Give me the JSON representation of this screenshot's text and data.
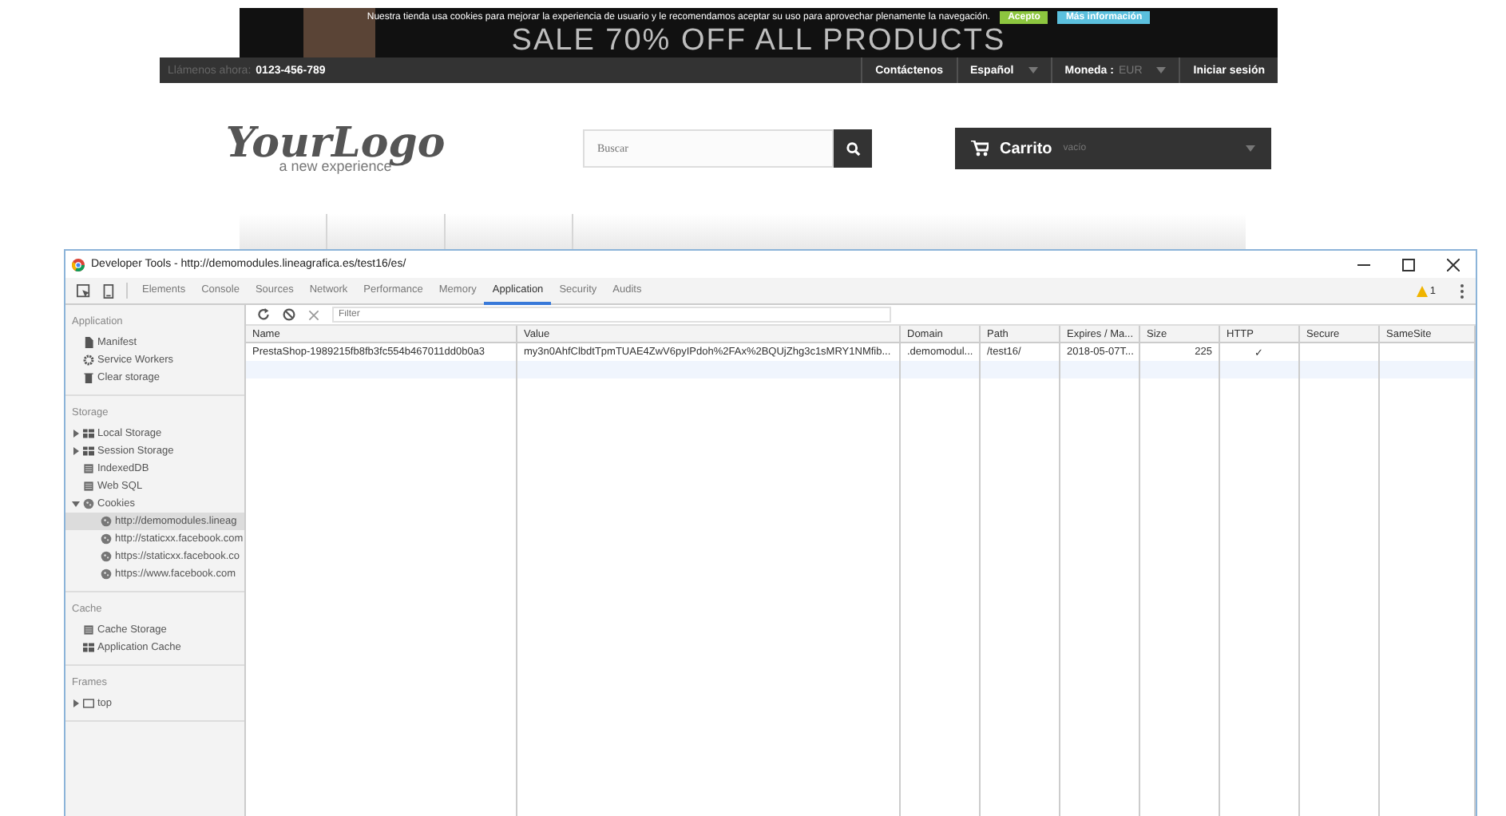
{
  "site": {
    "cookie_notice": {
      "text": "Nuestra tienda usa cookies para mejorar la experiencia de usuario y le recomendamos aceptar su uso para aprovechar plenamente la navegación.",
      "buttons": [
        {
          "label": "Acepto",
          "kind": "accept"
        },
        {
          "label": "Más información",
          "kind": "info"
        }
      ]
    },
    "banner_text": "SALE 70% OFF ALL PRODUCTS",
    "nav": {
      "call_label": "Llámenos ahora:",
      "phone": "0123-456-789",
      "links": [
        {
          "label": "Contáctenos",
          "dropdown": false
        },
        {
          "label": "Español",
          "dropdown": true
        },
        {
          "label": "Moneda :",
          "value": "EUR",
          "dropdown": true
        },
        {
          "label": "Iniciar sesión",
          "dropdown": false
        }
      ]
    },
    "logo": {
      "title": "YourLogo",
      "tagline": "a new experience"
    },
    "search": {
      "placeholder": "Buscar"
    },
    "cart": {
      "label": "Carrito",
      "status": "vacío"
    }
  },
  "devtools": {
    "title": "Developer Tools - http://demomodules.lineagrafica.es/test16/es/",
    "tabs": [
      {
        "label": "Elements",
        "selected": false
      },
      {
        "label": "Console",
        "selected": false
      },
      {
        "label": "Sources",
        "selected": false
      },
      {
        "label": "Network",
        "selected": false
      },
      {
        "label": "Performance",
        "selected": false
      },
      {
        "label": "Memory",
        "selected": false
      },
      {
        "label": "Application",
        "selected": true
      },
      {
        "label": "Security",
        "selected": false
      },
      {
        "label": "Audits",
        "selected": false
      }
    ],
    "warnings": "1",
    "sidebar": [
      {
        "heading": "Application",
        "items": [
          {
            "label": "Manifest",
            "kind": "document",
            "selected": false
          },
          {
            "label": "Service Workers",
            "kind": "gear",
            "selected": false
          },
          {
            "label": "Clear storage",
            "kind": "bin",
            "selected": false
          }
        ]
      },
      {
        "heading": "Storage",
        "items": [
          {
            "label": "Local Storage",
            "kind": "grid",
            "selected": false,
            "expanded": false
          },
          {
            "label": "Session Storage",
            "kind": "grid",
            "selected": false,
            "expanded": false
          },
          {
            "label": "IndexedDB",
            "kind": "database",
            "selected": false
          },
          {
            "label": "Web SQL",
            "kind": "database",
            "selected": false
          },
          {
            "label": "Cookies",
            "kind": "cookie",
            "selected": false,
            "expanded": true,
            "children": [
              {
                "label": "http://demomodules.lineag",
                "kind": "cookie",
                "selected": true
              },
              {
                "label": "http://staticxx.facebook.com",
                "kind": "cookie",
                "selected": false
              },
              {
                "label": "https://staticxx.facebook.co",
                "kind": "cookie",
                "selected": false
              },
              {
                "label": "https://www.facebook.com",
                "kind": "cookie",
                "selected": false
              }
            ]
          }
        ]
      },
      {
        "heading": "Cache",
        "items": [
          {
            "label": "Cache Storage",
            "kind": "database",
            "selected": false
          },
          {
            "label": "Application Cache",
            "kind": "grid",
            "selected": false
          }
        ]
      },
      {
        "heading": "Frames",
        "items": [
          {
            "label": "top",
            "kind": "frame",
            "selected": false,
            "expanded": false
          }
        ]
      }
    ],
    "filter": {
      "placeholder": "Filter"
    },
    "table": {
      "columns": [
        {
          "label": "Name",
          "kind": "text"
        },
        {
          "label": "Value",
          "kind": "text"
        },
        {
          "label": "Domain",
          "kind": "text"
        },
        {
          "label": "Path",
          "kind": "text"
        },
        {
          "label": "Expires / Ma...",
          "kind": "text"
        },
        {
          "label": "Size",
          "kind": "number"
        },
        {
          "label": "HTTP",
          "kind": "flag"
        },
        {
          "label": "Secure",
          "kind": "flag"
        },
        {
          "label": "SameSite",
          "kind": "text"
        }
      ],
      "rows": [
        {
          "cells": [
            "PrestaShop-1989215fb8fb3fc554b467011dd0b0a3",
            "my3n0AhfClbdtTpmTUAE4ZwV6pyIPdoh%2FAx%2BQUjZhg3c1sMRY1NMfib...",
            ".demomodul...",
            "/test16/",
            "2018-05-07T...",
            "225",
            "✓"
          ],
          "selected": false
        }
      ]
    }
  }
}
